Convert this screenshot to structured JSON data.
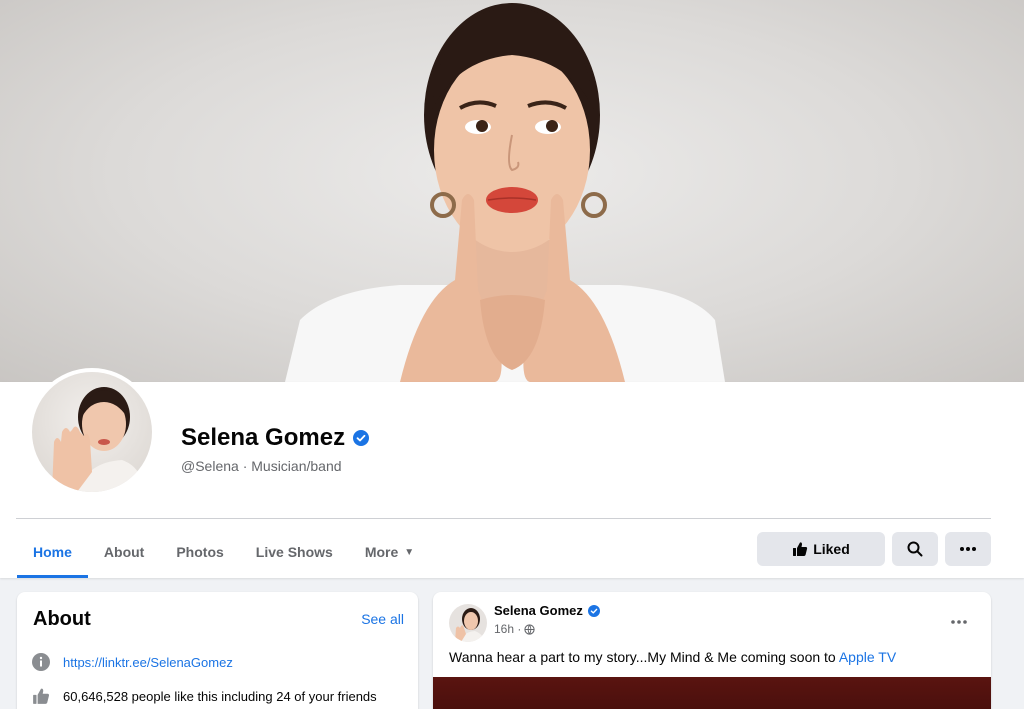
{
  "profile": {
    "name": "Selena Gomez",
    "handle_line": "@Selena · Musician/band"
  },
  "tabs": [
    {
      "label": "Home",
      "active": true
    },
    {
      "label": "About",
      "active": false
    },
    {
      "label": "Photos",
      "active": false
    },
    {
      "label": "Live Shows",
      "active": false
    },
    {
      "label": "More",
      "active": false
    }
  ],
  "actions": {
    "liked_label": "Liked"
  },
  "about": {
    "title": "About",
    "see_all": "See all",
    "link": "https://linktr.ee/SelenaGomez",
    "likes": "60,646,528 people like this including 24 of your friends"
  },
  "post": {
    "author": "Selena Gomez",
    "time": "16h ·",
    "text": "Wanna hear a part to my story...My Mind & Me coming soon to ",
    "link_text": "Apple TV"
  },
  "colors": {
    "accent": "#1b74e4",
    "button_gray": "#e4e6eb",
    "page_bg": "#f0f2f5"
  }
}
